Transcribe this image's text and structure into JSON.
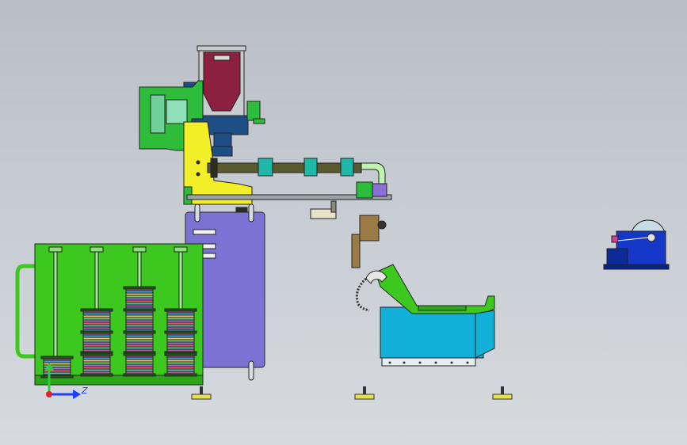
{
  "view": {
    "background_top": "#b9bec6",
    "background_bottom": "#d6dadf"
  },
  "triad": {
    "vertical_axis_color": "#2ecc40",
    "horizontal_axis_color": "#1f3fff",
    "origin_color": "#e0202a",
    "horizontal_axis_label": "Z"
  },
  "colors": {
    "hopper_frame": "#c9cccf",
    "hopper_bin": "#8b2040",
    "hopper_housing": "#1d4f86",
    "bracket_yellow": "#f2ee28",
    "drive_green": "#2ebd3a",
    "barrel": "#5a5a2e",
    "barrel_band": "#1fb8a8",
    "cooling_tank": "#10b0d8",
    "winder_frame": "#3cc81e",
    "panel": "#7b73d4",
    "takeup_unit": "#1638c8",
    "takeup_drum": "#c6dde6",
    "brown_box": "#9b7a46",
    "purple_box": "#8a6fd8"
  }
}
